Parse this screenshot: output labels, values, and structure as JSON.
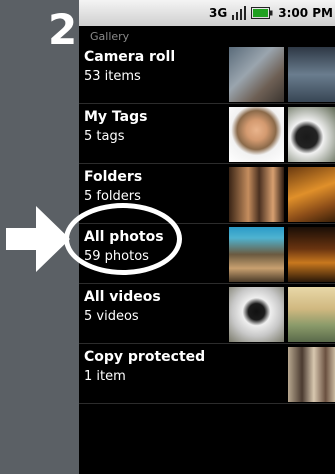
{
  "step": {
    "number": "2"
  },
  "status_bar": {
    "network": "3G",
    "time": "3:00 PM"
  },
  "gallery": {
    "title": "Gallery",
    "albums": [
      {
        "name": "Camera roll",
        "count": "53 items"
      },
      {
        "name": "My Tags",
        "count": "5 tags"
      },
      {
        "name": "Folders",
        "count": "5 folders"
      },
      {
        "name": "All photos",
        "count": "59 photos"
      },
      {
        "name": "All videos",
        "count": "5 videos"
      },
      {
        "name": "Copy protected",
        "count": "1 item"
      }
    ]
  },
  "colors": {
    "background_frame": "#5b6065",
    "phone_background": "#000000",
    "status_bar": "#dcdcdc",
    "highlight_ring": "#ffffff",
    "battery": "#1fa01f"
  },
  "icons": [
    "arrow-right-icon",
    "signal-icon",
    "battery-icon"
  ]
}
